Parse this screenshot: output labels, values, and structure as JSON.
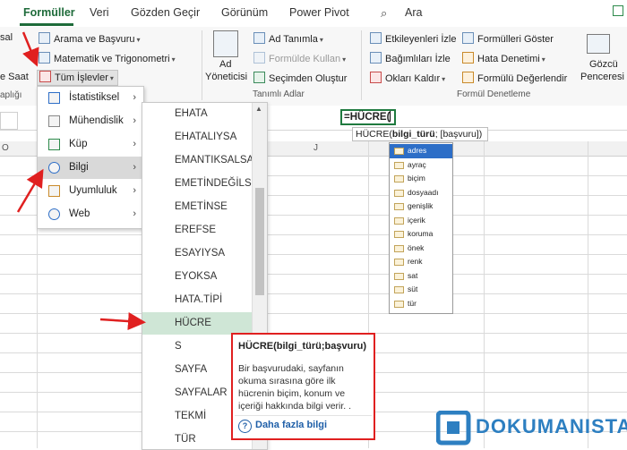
{
  "tabs": [
    "Formüller",
    "Veri",
    "Gözden Geçir",
    "Görünüm",
    "Power Pivot",
    "Ara"
  ],
  "ribbon": {
    "left_partial": [
      "sal",
      "e Saat",
      "aplığı"
    ],
    "lookup": "Arama ve Başvuru",
    "math": "Matematik ve Trigonometri",
    "all_functions": "Tüm İşlevler",
    "define_name": "Ad Tanımla",
    "use_in_formula": "Formülde Kullan",
    "create_from_selection": "Seçimden Oluştur",
    "name_manager_line1": "Ad",
    "name_manager_line2": "Yöneticisi",
    "defined_names_group": "Tanımlı Adlar",
    "trace_precedents": "Etkileyenleri İzle",
    "trace_dependents": "Bağımlıları İzle",
    "remove_arrows": "Okları Kaldır",
    "show_formulas": "Formülleri Göster",
    "error_checking": "Hata Denetimi",
    "evaluate_formula": "Formülü Değerlendir",
    "formula_auditing_group": "Formül Denetleme",
    "watch_line1": "Gözcü",
    "watch_line2": "Penceresi"
  },
  "sheet": {
    "col_o": "O",
    "col_j": "J"
  },
  "menu": [
    {
      "label": "İstatistiksel"
    },
    {
      "label": "Mühendislik"
    },
    {
      "label": "Küp"
    },
    {
      "label": "Bilgi"
    },
    {
      "label": "Uyumluluk"
    },
    {
      "label": "Web"
    }
  ],
  "functions": [
    "EHATA",
    "EHATALIYSA",
    "EMANTIKSALSA",
    "EMETİNDEĞİLSE",
    "EMETİNSE",
    "EREFSE",
    "ESAYIYSA",
    "EYOKSA",
    "HATA.TİPİ",
    "HÜCRE",
    "S",
    "SAYFA",
    "SAYFALAR",
    "TEKMİ",
    "TÜR"
  ],
  "tooltip": {
    "title": "HÜCRE(bilgi_türü;başvuru)",
    "body": "Bir başvurudaki, sayfanın okuma sırasına göre ilk hücrenin biçim, konum ve içeriği hakkında bilgi verir. .",
    "link": "Daha fazla bilgi"
  },
  "formula": {
    "cell_text": "=HÜCRE(",
    "hint_fn": "HÜCRE(",
    "hint_arg1": "bilgi_türü",
    "hint_rest": "; [başvuru])"
  },
  "autocomplete": [
    "adres",
    "ayraç",
    "biçim",
    "dosyaadı",
    "genişlik",
    "içerik",
    "koruma",
    "önek",
    "renk",
    "sat",
    "süt",
    "tür"
  ],
  "logo": "DOKUMANISTAN",
  "colors": {
    "accent_green": "#1e6b3a",
    "selection_green": "#cfe6d6",
    "arrow_red": "#e02020",
    "ac_blue": "#2d6ec7"
  }
}
